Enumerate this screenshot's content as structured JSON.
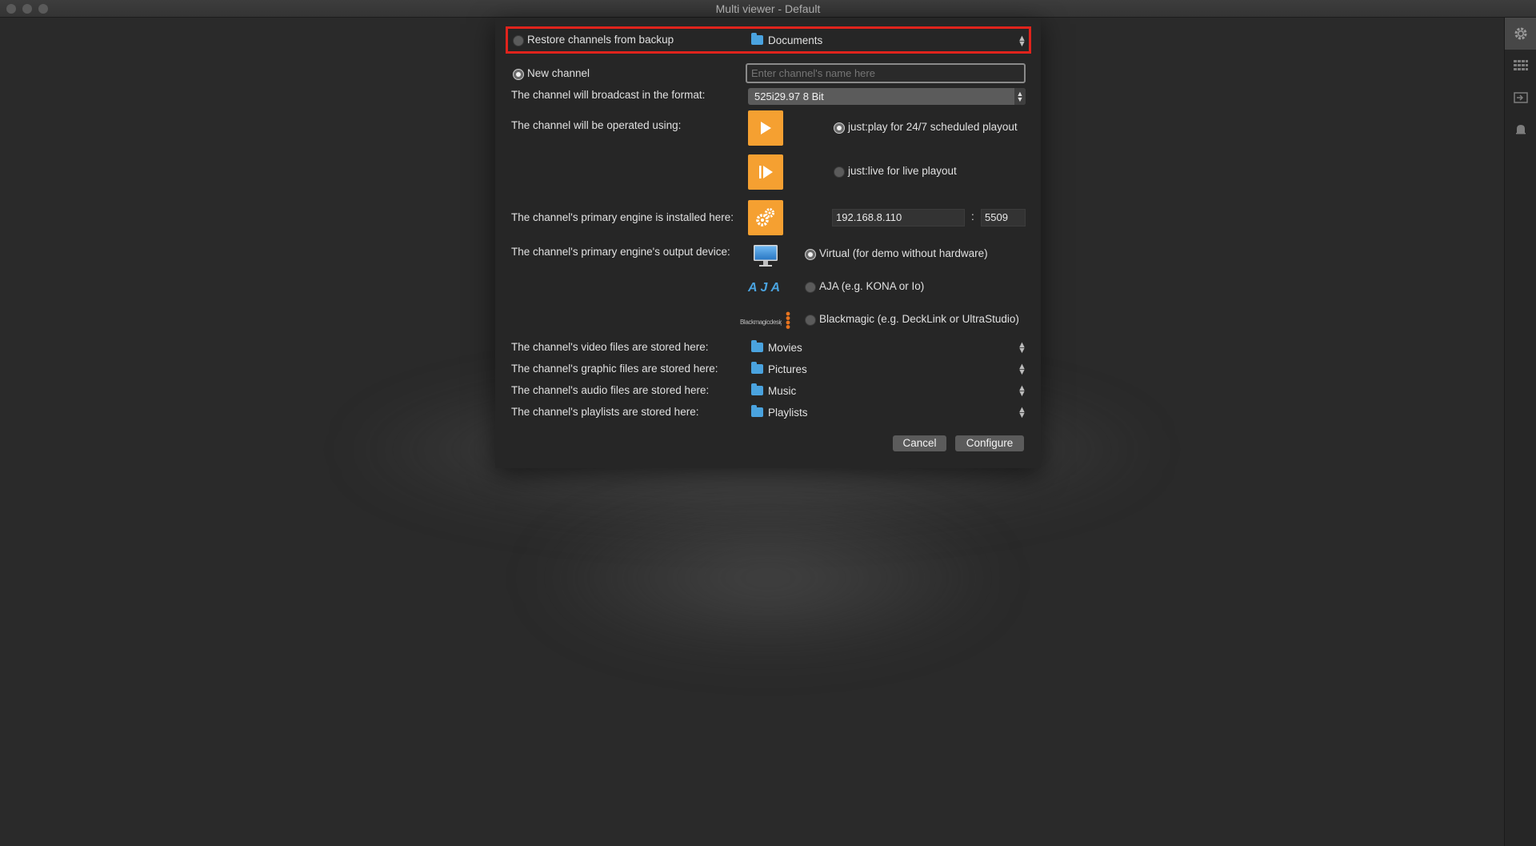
{
  "window": {
    "title": "Multi viewer - Default"
  },
  "dialog": {
    "restore": {
      "label": "Restore channels from backup",
      "folder": "Documents"
    },
    "new_channel": {
      "label": "New channel",
      "name_placeholder": "Enter channel's name here"
    },
    "format": {
      "label": "The channel will broadcast in the format:",
      "value": "525i29.97 8 Bit"
    },
    "operated": {
      "label": "The channel will be operated using:",
      "options": [
        {
          "label": "just:play for 24/7 scheduled playout",
          "checked": true
        },
        {
          "label": "just:live for live playout",
          "checked": false
        }
      ]
    },
    "engine": {
      "label": "The channel's primary engine is installed here:",
      "ip": "192.168.8.110",
      "separator": ":",
      "port": "5509"
    },
    "output": {
      "label": "The channel's primary engine's output device:",
      "options": [
        {
          "label": "Virtual (for demo without hardware)",
          "checked": true
        },
        {
          "label": "AJA (e.g. KONA or Io)",
          "checked": false
        },
        {
          "label": "Blackmagic (e.g. DeckLink or UltraStudio)",
          "checked": false
        }
      ],
      "logos": {
        "aja_text": "AJA",
        "blackmagic_text": "Blackmagicdesign"
      }
    },
    "storage": [
      {
        "label": "The channel's video files are stored here:",
        "folder": "Movies"
      },
      {
        "label": "The channel's graphic files are stored here:",
        "folder": "Pictures"
      },
      {
        "label": "The channel's audio files are stored here:",
        "folder": "Music"
      },
      {
        "label": "The channel's playlists are stored here:",
        "folder": "Playlists"
      }
    ],
    "buttons": {
      "cancel": "Cancel",
      "configure": "Configure"
    }
  },
  "colors": {
    "accent_orange": "#f5a031",
    "highlight_red": "#e0231c",
    "folder_blue": "#4aa3df"
  },
  "icons": {
    "sidebar": [
      "gear-icon",
      "grid-icon",
      "input-icon",
      "bell-icon"
    ],
    "operated": [
      "play-icon",
      "live-play-icon"
    ],
    "engine": "engine-gears-icon",
    "output": [
      "monitor-icon",
      "aja-logo",
      "blackmagic-logo"
    ]
  }
}
